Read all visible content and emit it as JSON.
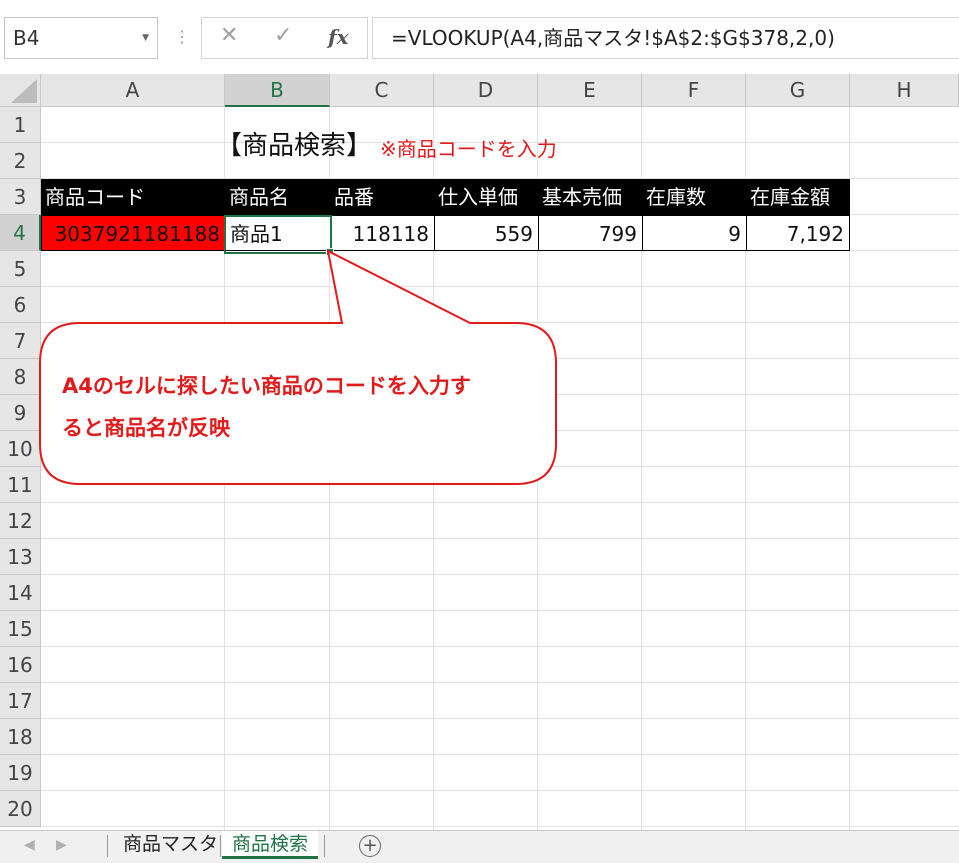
{
  "name_box": {
    "value": "B4"
  },
  "formula_bar": {
    "cancel_icon": "✕",
    "enter_icon": "✓",
    "fx_label": "fx",
    "formula": "=VLOOKUP(A4,商品マスタ!$A$2:$G$378,2,0)"
  },
  "columns": [
    "A",
    "B",
    "C",
    "D",
    "E",
    "F",
    "G",
    "H"
  ],
  "rows": [
    "1",
    "2",
    "3",
    "4",
    "5",
    "6",
    "7",
    "8",
    "9",
    "10",
    "11",
    "12",
    "13",
    "14",
    "15",
    "16",
    "17",
    "18",
    "19",
    "20"
  ],
  "sheet": {
    "title": "【商品検索】",
    "hint": "※商品コードを入力",
    "table_headers": [
      "商品コード",
      "商品名",
      "品番",
      "仕入単価",
      "基本売価",
      "在庫数",
      "在庫金額"
    ],
    "table_row": [
      "3037921181188",
      "商品1",
      "118118",
      "559",
      "799",
      "9",
      "7,192"
    ]
  },
  "callout": {
    "line1": "A4のセルに探したい商品のコードを入力す",
    "line2": "ると商品名が反映"
  },
  "tabs": {
    "items": [
      "商品マスタ",
      "商品検索"
    ],
    "active": "商品検索",
    "add_icon": "⊕"
  },
  "colors": {
    "accent": "#217346",
    "highlight": "#ff0000",
    "callout_text": "#e11b1b",
    "header_bg": "#000000"
  }
}
